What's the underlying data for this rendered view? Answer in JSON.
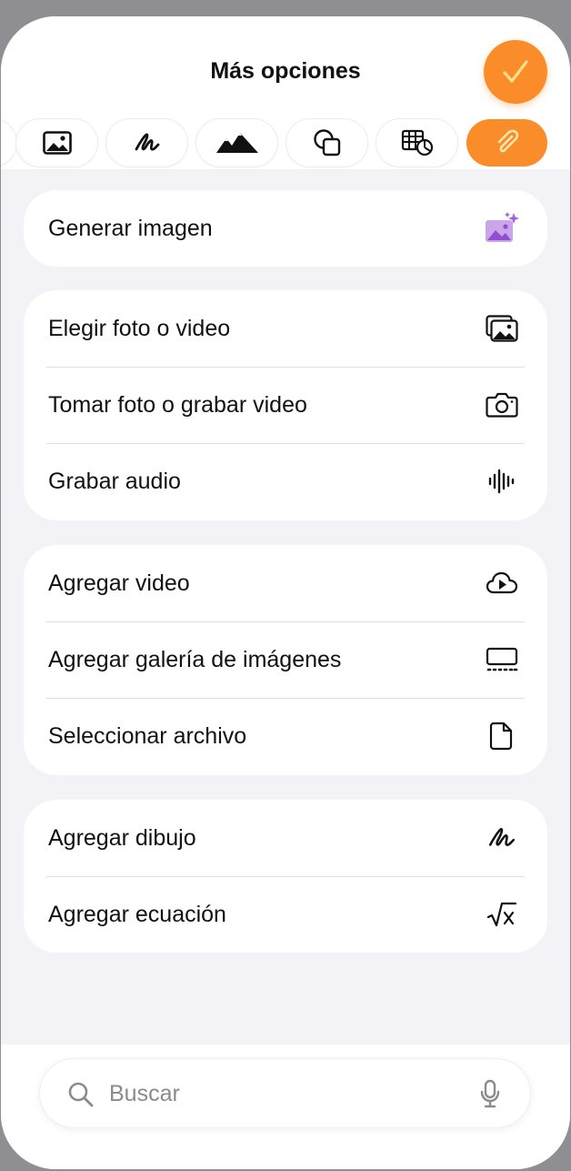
{
  "header": {
    "title": "Más opciones"
  },
  "colors": {
    "accent": "#fb8c2a",
    "purple": "#b36be8"
  },
  "tabs": [
    {
      "icon": "partial-tab-icon",
      "active": false
    },
    {
      "icon": "photo-icon",
      "active": false
    },
    {
      "icon": "scribble-icon",
      "active": false
    },
    {
      "icon": "mountains-icon",
      "active": false
    },
    {
      "icon": "shapes-icon",
      "active": false
    },
    {
      "icon": "table-chart-icon",
      "active": false
    },
    {
      "icon": "paperclip-icon",
      "active": true
    }
  ],
  "groups": [
    {
      "items": [
        {
          "label": "Generar imagen",
          "icon": "generate-image-icon"
        }
      ]
    },
    {
      "items": [
        {
          "label": "Elegir foto o video",
          "icon": "photo-library-icon"
        },
        {
          "label": "Tomar foto o grabar video",
          "icon": "camera-icon"
        },
        {
          "label": "Grabar audio",
          "icon": "waveform-icon"
        }
      ]
    },
    {
      "items": [
        {
          "label": "Agregar video",
          "icon": "cloud-play-icon"
        },
        {
          "label": "Agregar galería de imágenes",
          "icon": "gallery-icon"
        },
        {
          "label": "Seleccionar archivo",
          "icon": "document-icon"
        }
      ]
    },
    {
      "items": [
        {
          "label": "Agregar dibujo",
          "icon": "scribble-icon"
        },
        {
          "label": "Agregar ecuación",
          "icon": "square-root-icon"
        }
      ]
    }
  ],
  "search": {
    "placeholder": "Buscar"
  }
}
